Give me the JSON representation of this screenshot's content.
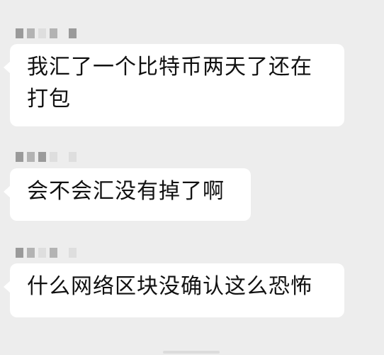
{
  "messages": [
    {
      "text": "我汇了一个比特币两天了还在打包"
    },
    {
      "text": "会不会汇没有掉了啊"
    },
    {
      "text": "什么网络区块没确认这么恐怖"
    }
  ]
}
